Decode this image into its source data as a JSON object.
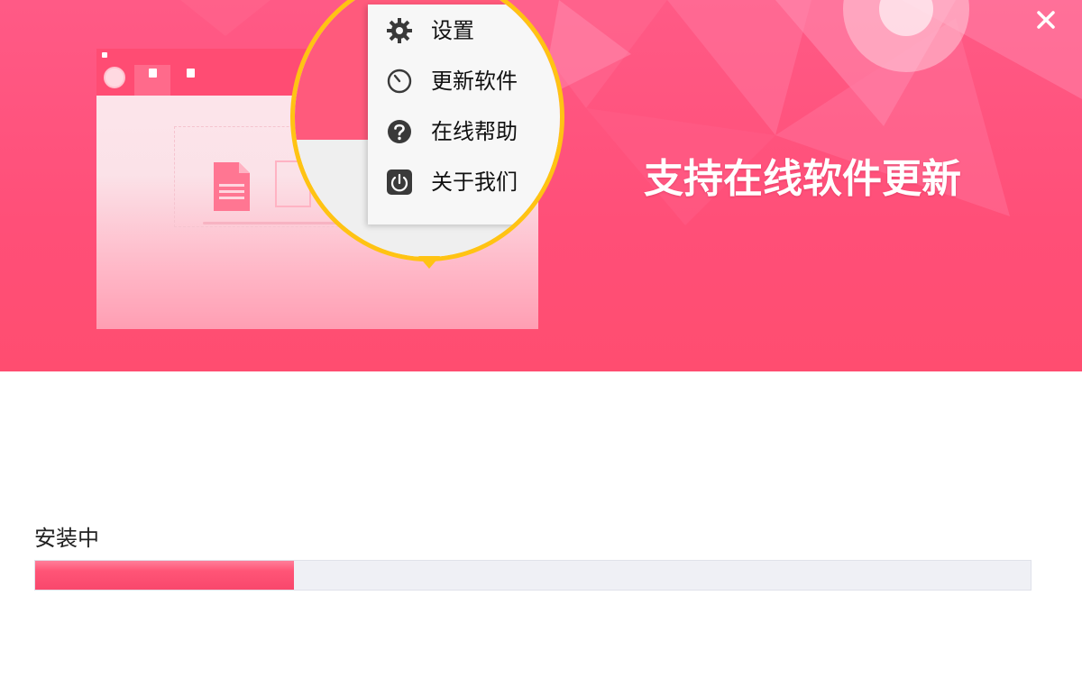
{
  "banner": {
    "headline": "支持在线软件更新",
    "close_icon": "close-icon",
    "accent_color": "#ff4f78",
    "magnifier_border_color": "#ffc313"
  },
  "preview": {
    "menu": [
      {
        "icon": "gear-icon",
        "label": "设置"
      },
      {
        "icon": "clock-icon",
        "label": "更新软件"
      },
      {
        "icon": "question-icon",
        "label": "在线帮助"
      },
      {
        "icon": "power-icon",
        "label": "关于我们"
      }
    ]
  },
  "install": {
    "status_label": "安装中",
    "progress": 0.26
  }
}
